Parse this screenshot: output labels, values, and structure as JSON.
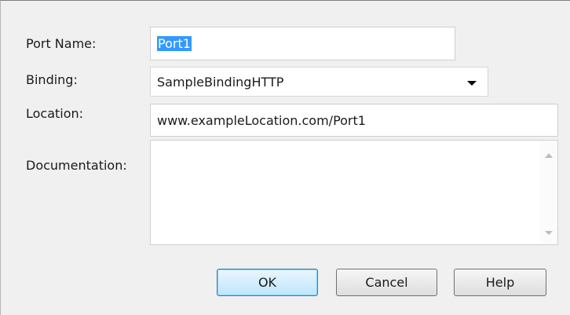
{
  "form": {
    "port_name_label": "Port Name:",
    "port_name_value": "Port1",
    "binding_label": "Binding:",
    "binding_value": "SampleBindingHTTP",
    "location_label": "Location:",
    "location_value": "www.exampleLocation.com/Port1",
    "documentation_label": "Documentation:",
    "documentation_value": ""
  },
  "buttons": {
    "ok": "OK",
    "cancel": "Cancel",
    "help": "Help"
  },
  "icons": {
    "combo_arrow": "chevron-down-icon",
    "scroll_up": "scroll-up-icon",
    "scroll_down": "scroll-down-icon"
  },
  "colors": {
    "selection": "#3399ff",
    "default_button_border": "#3c7fb1",
    "dialog_background": "#f0f0f0"
  }
}
